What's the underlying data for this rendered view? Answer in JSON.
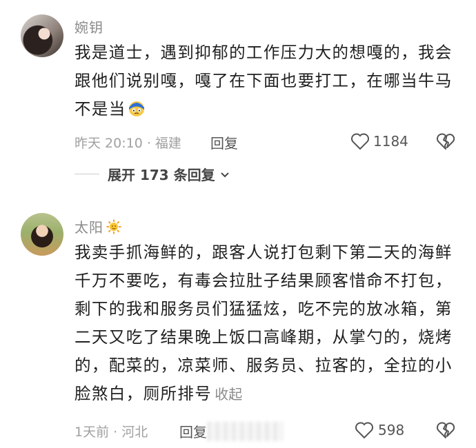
{
  "comments": [
    {
      "username": "婉钥",
      "text": "我是道士，遇到抑郁的工作压力大的想嘎的，我会跟他们说别嘎，嘎了在下面也要打工，在哪当牛马不是当",
      "time": "昨天 20:10 · 福建",
      "reply_label": "回复",
      "likes": "1184",
      "emoji_icon": "crying-blue-face-emoji",
      "expand_label": "展开 173 条回复"
    },
    {
      "username": "太阳",
      "username_icon": "sun-emoji",
      "text": "我卖手抓海鲜的，跟客人说打包剩下第二天的海鲜千万不要吃，有毒会拉肚子结果顾客惜命不打包，剩下的我和服务员们猛猛炫，吃不完的放冰箱，第二天又吃了结果晚上饭口高峰期，从掌勺的，烧烤的，配菜的，凉菜师、服务员、拉客的，全拉的小脸煞白，厕所排号",
      "collapse_label": "收起",
      "time": "1天前 · 河北",
      "reply_label": "回复",
      "likes": "598"
    }
  ]
}
